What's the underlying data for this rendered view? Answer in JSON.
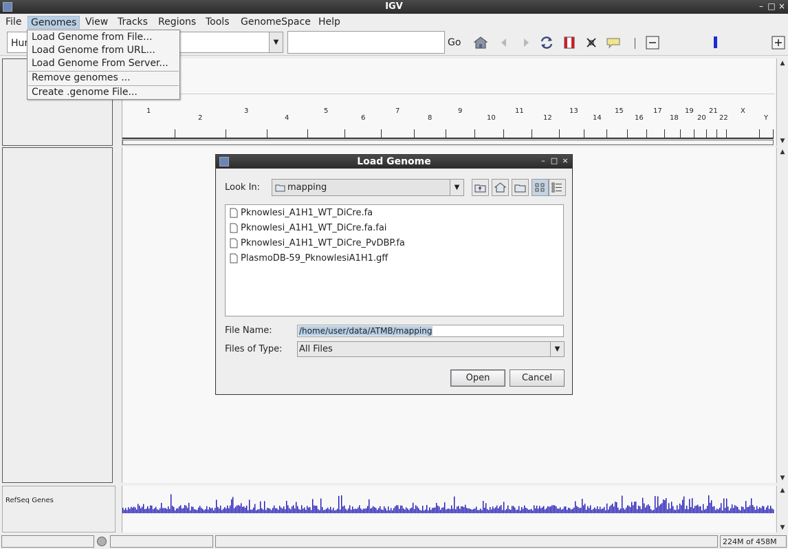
{
  "window": {
    "title": "IGV"
  },
  "menubar": {
    "items": [
      {
        "label": "File"
      },
      {
        "label": "Genomes"
      },
      {
        "label": "View"
      },
      {
        "label": "Tracks"
      },
      {
        "label": "Regions"
      },
      {
        "label": "Tools"
      },
      {
        "label": "GenomeSpace"
      },
      {
        "label": "Help"
      }
    ]
  },
  "genomes_menu": {
    "items": [
      {
        "label": "Load Genome from File..."
      },
      {
        "label": "Load Genome from URL..."
      },
      {
        "label": "Load Genome From Server..."
      },
      {
        "label": "Remove genomes ..."
      },
      {
        "label": "Create .genome File..."
      }
    ]
  },
  "toolbar": {
    "genome_value": "Hur",
    "locus_value": "",
    "go_label": "Go"
  },
  "ruler": {
    "chromosomes": [
      "1",
      "2",
      "3",
      "4",
      "5",
      "6",
      "7",
      "8",
      "9",
      "10",
      "11",
      "12",
      "13",
      "14",
      "15",
      "16",
      "17",
      "18",
      "19",
      "20",
      "21",
      "22",
      "X",
      "Y"
    ]
  },
  "tracks": {
    "refseq_label": "RefSeq Genes"
  },
  "status": {
    "memory": "224M of 458M"
  },
  "dialog": {
    "title": "Load Genome",
    "look_in_label": "Look In:",
    "look_in_value": "mapping",
    "files": [
      {
        "name": "Pknowlesi_A1H1_WT_DiCre.fa"
      },
      {
        "name": "Pknowlesi_A1H1_WT_DiCre.fa.fai"
      },
      {
        "name": "Pknowlesi_A1H1_WT_DiCre_PvDBP.fa"
      },
      {
        "name": "PlasmoDB-59_PknowlesiA1H1.gff"
      }
    ],
    "file_name_label": "File Name:",
    "file_name_value": "/home/user/data/ATMB/mapping",
    "files_of_type_label": "Files of Type:",
    "files_of_type_value": "All Files",
    "open_label": "Open",
    "cancel_label": "Cancel"
  }
}
